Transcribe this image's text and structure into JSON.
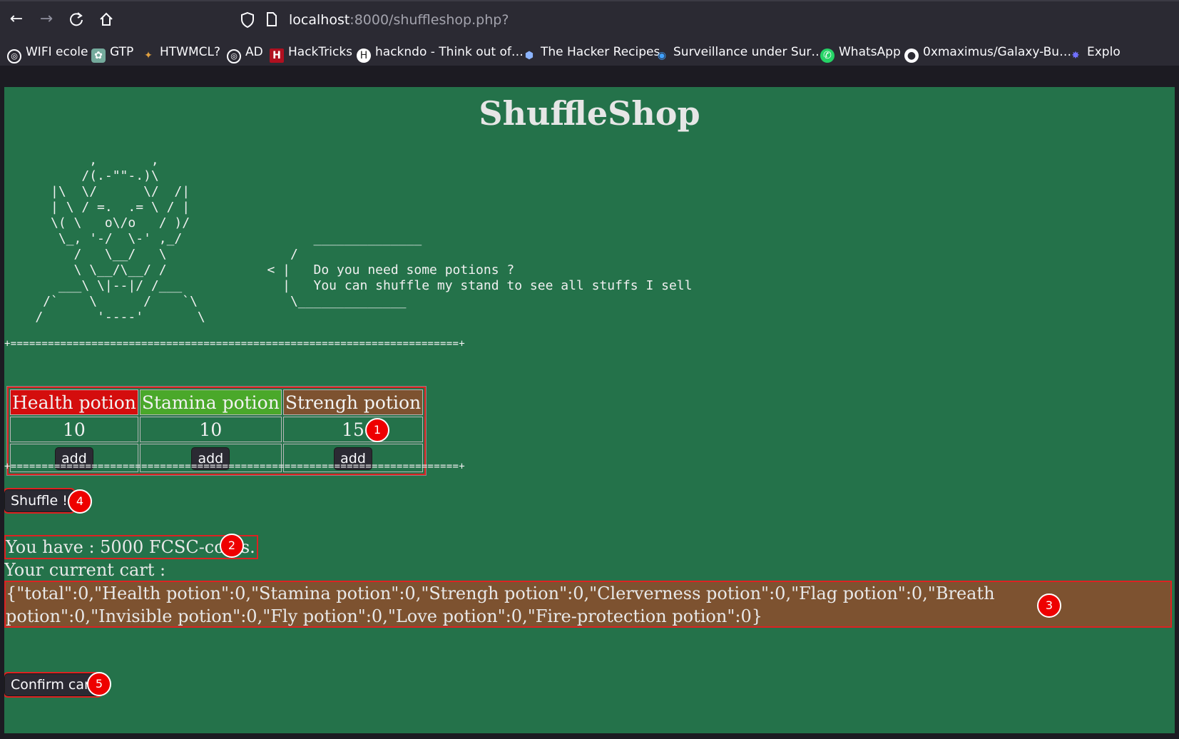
{
  "browser": {
    "url_host": "localhost",
    "url_path": ":8000/shuffleshop.php?",
    "bookmarks": [
      {
        "label": "WIFI ecole",
        "icon": "globe-icon"
      },
      {
        "label": "GTP",
        "icon": "chatgpt-icon"
      },
      {
        "label": "HTWMCL?",
        "icon": "runner-icon"
      },
      {
        "label": "AD",
        "icon": "globe-icon"
      },
      {
        "label": "HackTricks",
        "icon": "hacktricks-icon"
      },
      {
        "label": "hackndo - Think out of…",
        "icon": "hackndo-icon"
      },
      {
        "label": "The Hacker Recipes",
        "icon": "hacker-recipes-icon"
      },
      {
        "label": "Surveillance under Sur…",
        "icon": "eye-icon"
      },
      {
        "label": "WhatsApp",
        "icon": "whatsapp-icon"
      },
      {
        "label": "0xmaximus/Galaxy-Bu…",
        "icon": "github-icon"
      },
      {
        "label": "Explo",
        "icon": "bug-icon"
      }
    ]
  },
  "page": {
    "title": "ShuffleShop",
    "ascii_art": "           ,       ,\n          /(.-\"\"-.)\\\n      |\\  \\/      \\/  /|\n      | \\ / =.  .= \\ / |\n      \\( \\   o\\/o   / )/\n       \\_, '-/  \\-' ,_/                 ______________\n         /   \\__/   \\                /\n         \\ \\__/\\__/ /             < |   Do you need some potions ?\n       ___\\ \\|--|/ /___             |   You can shuffle my stand to see all stuffs I sell\n     /`    \\      /    `\\            \\______________\n    /       '----'       \\",
    "divider": "+========================================================================+",
    "products": [
      {
        "name": "Health potion",
        "price": "10",
        "button": "add",
        "color": "#d40d0d"
      },
      {
        "name": "Stamina potion",
        "price": "10",
        "button": "add",
        "color": "#4aa82a"
      },
      {
        "name": "Strengh potion",
        "price": "15",
        "button": "add",
        "color": "#7d5230"
      }
    ],
    "shuffle_label": "Shuffle !",
    "coins_text": "You have : 5000 FCSC-coins.",
    "cart_label": "Your current cart :",
    "cart_json": "{\"total\":0,\"Health potion\":0,\"Stamina potion\":0,\"Strengh potion\":0,\"Clerverness potion\":0,\"Flag potion\":0,\"Breath potion\":0,\"Invisible potion\":0,\"Fly potion\":0,\"Love potion\":0,\"Fire-protection potion\":0}",
    "confirm_label": "Confirm cart"
  },
  "annotations": {
    "markers": [
      "1",
      "2",
      "3",
      "4",
      "5"
    ],
    "color": "#e00000"
  }
}
